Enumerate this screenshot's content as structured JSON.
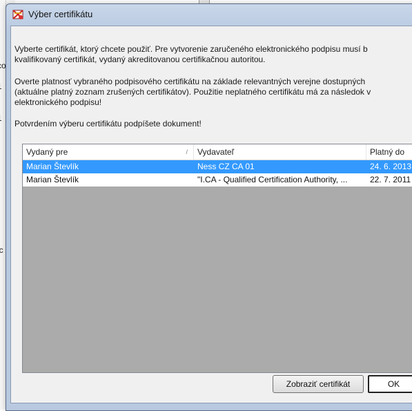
{
  "background": {
    "left_fragments": [
      "co",
      "1",
      "1",
      "ic"
    ]
  },
  "dialog": {
    "title": "Výber certifikátu",
    "para1_line1": "Vyberte certifikát, ktorý chcete použiť. Pre vytvorenie zaručeného elektronického podpisu musí b",
    "para1_line2": "kvalifikovaný certifikát, vydaný akreditovanou certifikačnou autoritou.",
    "para2_line1": "Overte platnosť vybraného podpisového certifikátu na základe relevantných verejne dostupných",
    "para2_line2": "(aktuálne platný zoznam zrušených certifikátov). Použitie neplatného certifikátu má za následok v",
    "para2_line3": "elektronického podpisu!",
    "para3": "Potvrdením výberu certifikátu podpíšete dokument!"
  },
  "table": {
    "headers": [
      "Vydaný pre",
      "Vydavateľ",
      "Platný do"
    ],
    "sort_indicator": "/",
    "rows": [
      {
        "issued_to": "Marian Števlík",
        "issuer": "Ness CZ CA 01",
        "valid_to": "24. 6. 2013",
        "selected": true
      },
      {
        "issued_to": "Marian Števlík",
        "issuer": "\"I.CA - Qualified Certification Authority, ...",
        "valid_to": "22. 7. 2011",
        "selected": false
      }
    ]
  },
  "buttons": {
    "show_cert": "Zobraziť certifikát",
    "ok": "OK"
  },
  "colors": {
    "selection": "#3399ff",
    "list_background": "#ababab",
    "title_bar": "#b8c9e0"
  }
}
